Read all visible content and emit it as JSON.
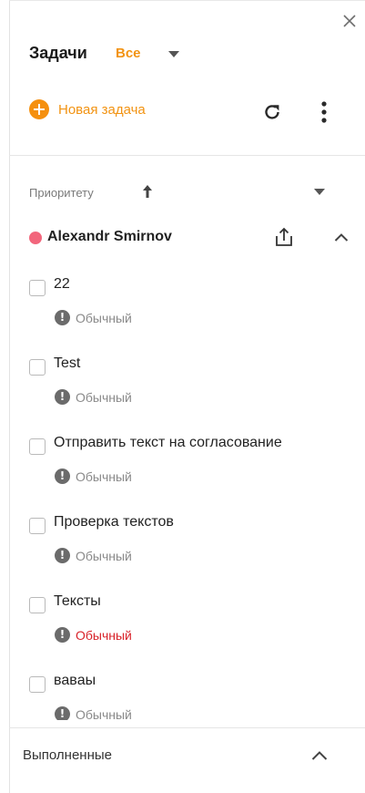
{
  "header": {
    "title": "Задачи",
    "filter_value": "Все",
    "close_icon": "close-icon"
  },
  "toolbar": {
    "new_task_label": "Новая задача",
    "icons": [
      "plus-circle-icon",
      "refresh-icon",
      "more-vertical-icon"
    ]
  },
  "sort": {
    "label": "Приоритету",
    "direction_icon": "arrow-up-icon"
  },
  "group": {
    "name": "Alexandr Smirnov",
    "dot_color": "#f2667c",
    "icons": [
      "share-icon",
      "chevron-up-icon"
    ]
  },
  "tasks": [
    {
      "title": "22",
      "priority": "Обычный",
      "priority_color": "#8a8a8a"
    },
    {
      "title": "Test",
      "priority": "Обычный",
      "priority_color": "#8a8a8a"
    },
    {
      "title": "Отправить текст на согласование",
      "priority": "Обычный",
      "priority_color": "#8a8a8a"
    },
    {
      "title": "Проверка текстов",
      "priority": "Обычный",
      "priority_color": "#8a8a8a"
    },
    {
      "title": "Тексты",
      "priority": "Обычный",
      "priority_color": "#d8232a"
    },
    {
      "title": "вавaы",
      "priority": "Обычный",
      "priority_color": "#8a8a8a"
    }
  ],
  "completed": {
    "label": "Выполненные"
  },
  "colors": {
    "accent": "#f29312",
    "priority_icon": "#6b6b6b"
  }
}
